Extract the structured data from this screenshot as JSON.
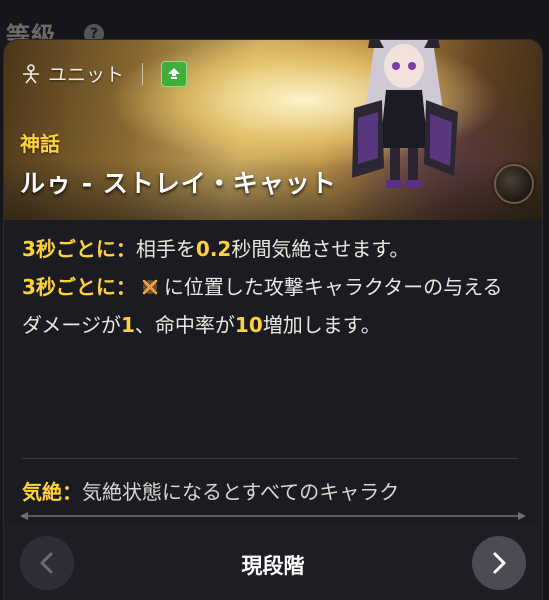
{
  "background": {
    "label": "等級",
    "help": "?"
  },
  "card": {
    "type_label": "ユニット",
    "rarity": "神話",
    "name": "ルゥ - ストレイ・キャット"
  },
  "description": {
    "line1": {
      "trigger": "3秒ごとに：",
      "pre": "相手を",
      "value": "0.2",
      "post": "秒間気絶させます。"
    },
    "line2": {
      "trigger": "3秒ごとに：",
      "pre": "に位置した攻撃キャラクターの与えるダメージが",
      "value1": "1",
      "mid": "、命中率が",
      "value2": "10",
      "post": "増加します。"
    }
  },
  "glossary": {
    "term": "気絶：",
    "text": "気絶状態になるとすべてのキャラク"
  },
  "footer": {
    "stage_label": "現段階"
  },
  "colors": {
    "accent_yellow": "#ffd23c",
    "rank_green": "#3fae3a"
  },
  "icons": {
    "unit": "unit-icon",
    "rank": "rank-up-icon",
    "position": "crossed-swords-icon",
    "prev": "chevron-left-icon",
    "next": "chevron-right-icon"
  }
}
